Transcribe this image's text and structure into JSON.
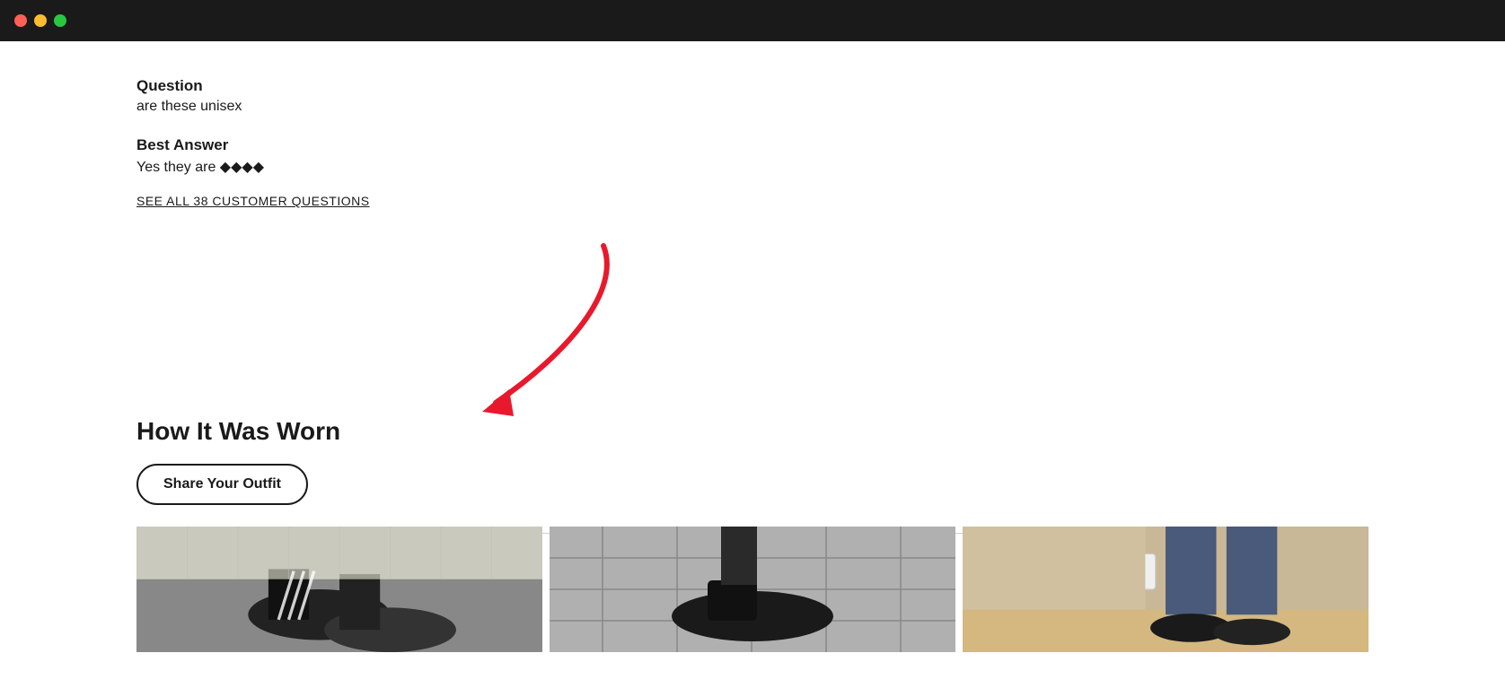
{
  "titlebar": {
    "close_color": "#ff5f57",
    "minimize_color": "#febc2e",
    "maximize_color": "#28c840"
  },
  "qa_section": {
    "question_label": "Question",
    "question_text": "are these unisex",
    "best_answer_label": "Best Answer",
    "best_answer_text": "Yes they are 🔷🔷🔷🔷",
    "see_all_link": "SEE ALL 38 CUSTOMER QUESTIONS"
  },
  "how_it_was_worn": {
    "section_title": "How It Was Worn",
    "share_button_label": "Share Your Outfit"
  }
}
